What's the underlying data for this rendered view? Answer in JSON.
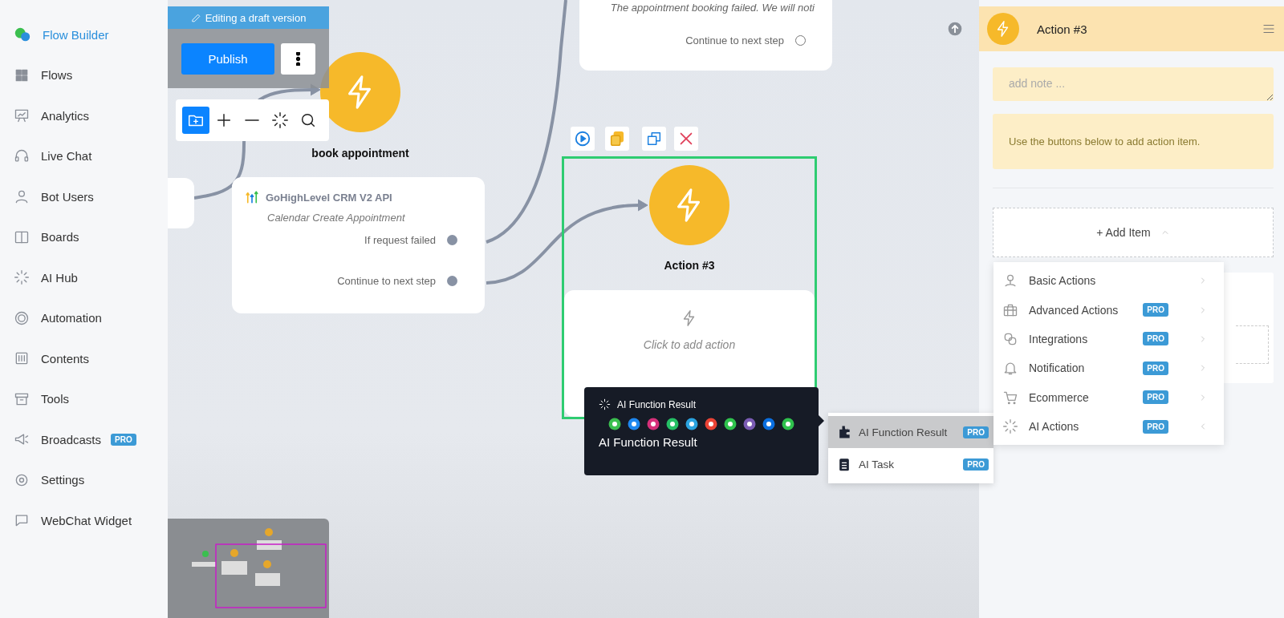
{
  "sidebar": {
    "brand": "Flow Builder",
    "items": [
      {
        "label": "Flows"
      },
      {
        "label": "Analytics"
      },
      {
        "label": "Live Chat"
      },
      {
        "label": "Bot Users"
      },
      {
        "label": "Boards"
      },
      {
        "label": "AI Hub"
      },
      {
        "label": "Automation"
      },
      {
        "label": "Contents"
      },
      {
        "label": "Tools"
      },
      {
        "label": "Broadcasts",
        "badge": "PRO"
      },
      {
        "label": "Settings"
      },
      {
        "label": "WebChat Widget"
      }
    ]
  },
  "canvas": {
    "draft_banner": "Editing a draft version",
    "publish_button": "Publish",
    "nodes": [
      {
        "kind": "start",
        "title": "book appointment"
      },
      {
        "kind": "action",
        "title": "Action #3",
        "selected": true
      }
    ],
    "cards": [
      {
        "kind": "api",
        "title": "GoHighLevel CRM V2 API",
        "subtitle": "Calendar Create Appointment",
        "outputs": [
          "If request failed",
          "Continue to next step"
        ]
      },
      {
        "kind": "message",
        "text": "The appointment booking failed. We will noti",
        "outputs": [
          "Continue to next step"
        ]
      },
      {
        "kind": "empty",
        "text": "Click to add action"
      }
    ],
    "tooltip": {
      "title": "AI Function Result",
      "text": "AI Function Result"
    },
    "submenu": [
      {
        "label": "AI Function Result",
        "badge": "PRO",
        "selected": true
      },
      {
        "label": "AI Task",
        "badge": "PRO",
        "selected": false
      }
    ]
  },
  "panel": {
    "title": "Action #3",
    "note": {
      "placeholder": "add note ..."
    },
    "info": "Use the buttons below to add action item.",
    "add_item": {
      "label": "+ Add Item",
      "expanded": true
    },
    "menu": [
      {
        "label": "Basic Actions",
        "expanded": false
      },
      {
        "label": "Advanced Actions",
        "badge": "PRO",
        "expanded": false
      },
      {
        "label": "Integrations",
        "badge": "PRO",
        "expanded": false
      },
      {
        "label": "Notification",
        "badge": "PRO",
        "expanded": false
      },
      {
        "label": "Ecommerce",
        "badge": "PRO",
        "expanded": false
      },
      {
        "label": "AI Actions",
        "badge": "PRO",
        "expanded": true
      }
    ]
  }
}
